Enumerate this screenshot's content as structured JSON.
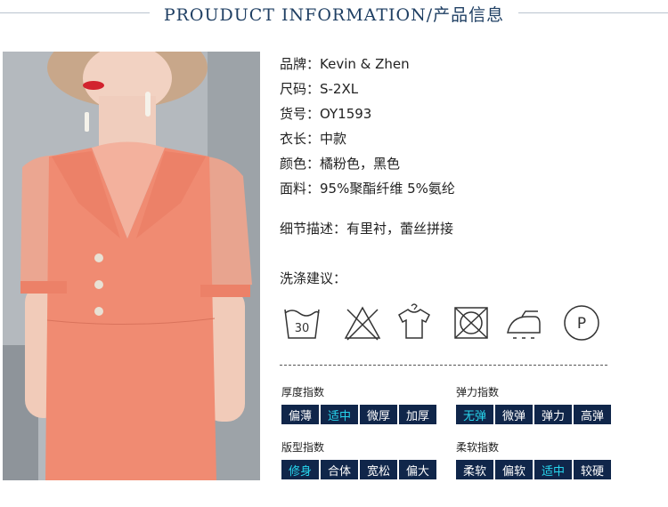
{
  "header": {
    "title": "PROUDUCT INFORMATION/产品信息"
  },
  "product": {
    "brand": "品牌：Kevin & Zhen",
    "size": "尺码：S-2XL",
    "item_no": "货号：OY1593",
    "length": "衣长：中款",
    "color": "颜色：橘粉色，黑色",
    "fabric": "面料：95%聚酯纤维 5%氨纶"
  },
  "detail": "细节描述：有里衬，蕾丝拼接",
  "washing": {
    "label": "洗涤建议：",
    "icons": [
      "wash-30-icon",
      "no-bleach-icon",
      "hang-dry-icon",
      "no-tumble-dry-icon",
      "iron-icon",
      "dry-clean-p-icon"
    ],
    "wash_temp": "30",
    "dry_clean_letter": "P"
  },
  "attributes": {
    "thickness": {
      "title": "厚度指数",
      "options": [
        "偏薄",
        "适中",
        "微厚",
        "加厚"
      ],
      "selected": "适中"
    },
    "elasticity": {
      "title": "弹力指数",
      "options": [
        "无弹",
        "微弹",
        "弹力",
        "高弹"
      ],
      "selected": "无弹"
    },
    "fit": {
      "title": "版型指数",
      "options": [
        "修身",
        "合体",
        "宽松",
        "偏大"
      ],
      "selected": "修身"
    },
    "softness": {
      "title": "柔软指数",
      "options": [
        "柔软",
        "偏软",
        "适中",
        "较硬"
      ],
      "selected": "适中"
    }
  },
  "colors": {
    "header_text": "#1f3f63",
    "tag_bg": "#10264a",
    "tag_text": "#ffffff",
    "tag_active": "#27d6ee",
    "dress": "#f08b72"
  }
}
